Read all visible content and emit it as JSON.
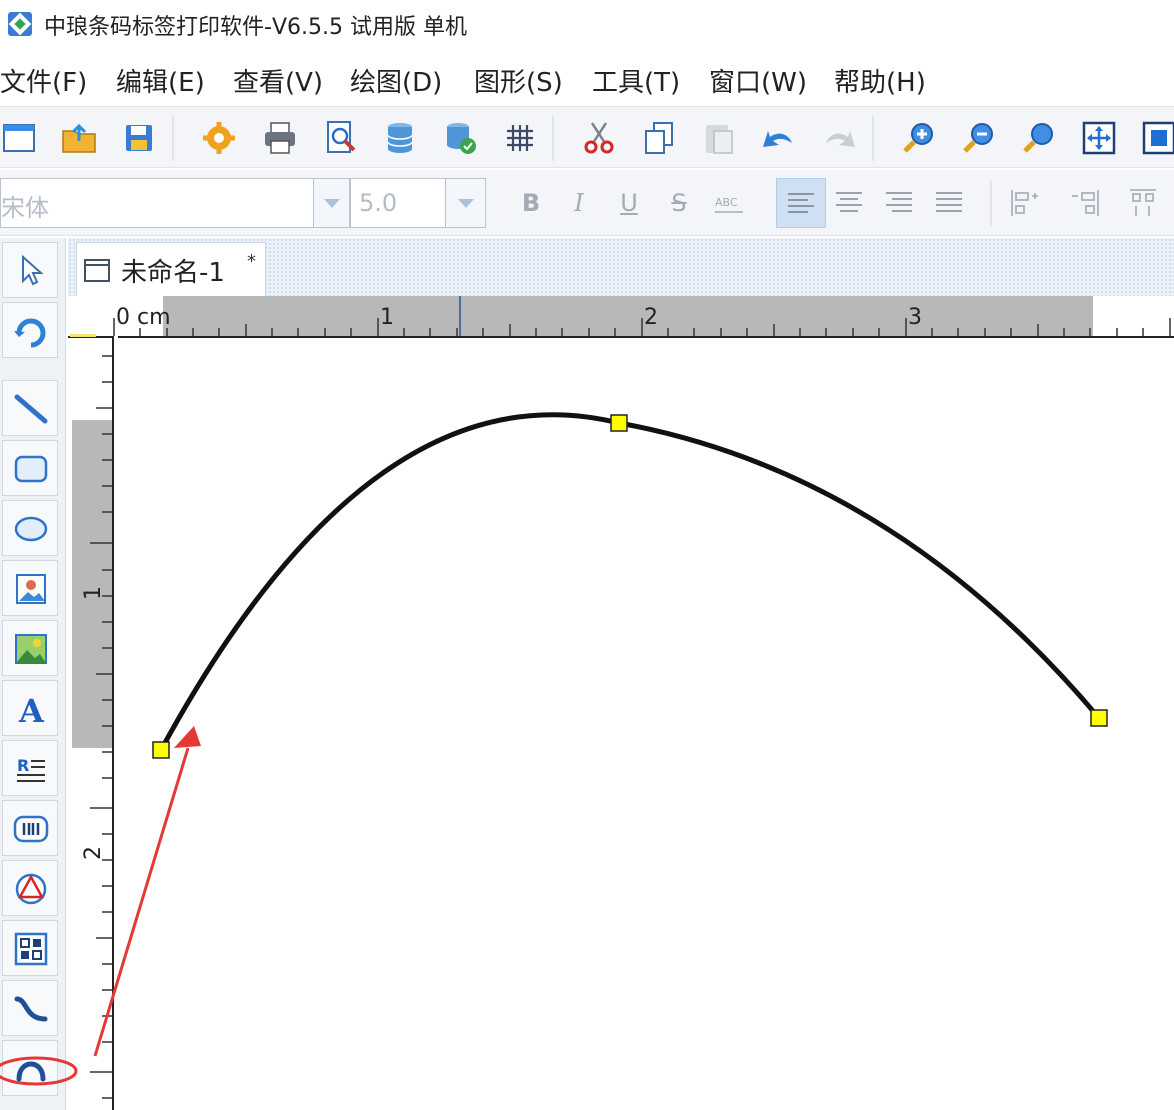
{
  "window": {
    "title": "中琅条码标签打印软件-V6.5.5 试用版 单机"
  },
  "menu": [
    "文件(F)",
    "编辑(E)",
    "查看(V)",
    "绘图(D)",
    "图形(S)",
    "工具(T)",
    "窗口(W)",
    "帮助(H)"
  ],
  "toolbar": {
    "icons": [
      "new-icon",
      "open-icon",
      "save-icon",
      "settings-icon",
      "print-icon",
      "print-preview-icon",
      "database-icon",
      "database-settings-icon",
      "grid-icon",
      "cut-icon",
      "copy-icon",
      "paste-icon",
      "undo-icon",
      "redo-icon",
      "zoom-in-icon",
      "zoom-out-icon",
      "zoom-icon",
      "fit-page-icon",
      "actual-size-icon"
    ]
  },
  "format_bar": {
    "font": "宋体",
    "size": "5.0",
    "bold": "B",
    "italic": "I",
    "underline": "U",
    "strike": "S",
    "active_alignment": "left"
  },
  "tools": [
    "select",
    "rotate",
    "line",
    "rectangle",
    "ellipse",
    "image",
    "picture",
    "text",
    "rich-text",
    "barcode",
    "shape",
    "qr-code",
    "curve",
    "arc"
  ],
  "document": {
    "tab_title": "未命名-1",
    "modified_marker": "*"
  },
  "ruler": {
    "unit": "cm",
    "top_labels": [
      "0 cm",
      "1",
      "2",
      "3"
    ],
    "left_labels": [
      "1",
      "2"
    ]
  },
  "accent": {
    "handle_fill": "#ffff00",
    "annotation": "#e53935",
    "selection_blue": "#cfe0f3"
  }
}
